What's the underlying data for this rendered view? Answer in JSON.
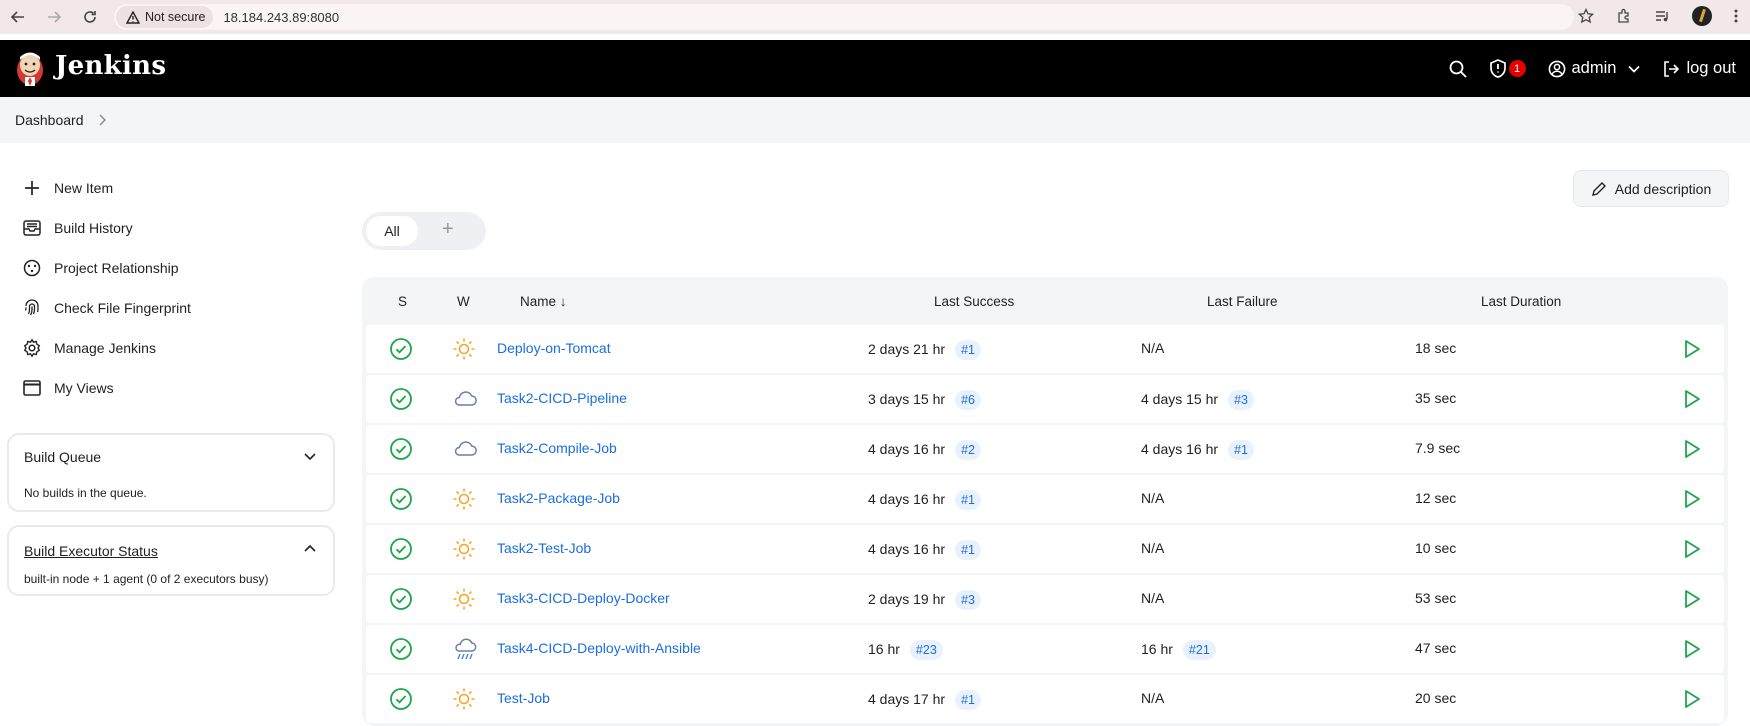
{
  "browser": {
    "not_secure_label": "Not secure",
    "url": "18.184.243.89:8080"
  },
  "header": {
    "title": "Jenkins",
    "security_badge_count": "1",
    "user": "admin",
    "logout": "log out"
  },
  "breadcrumb": {
    "item": "Dashboard"
  },
  "sidebar": {
    "tasks": [
      {
        "label": "New Item",
        "icon": "plus-icon"
      },
      {
        "label": "Build History",
        "icon": "inbox-icon"
      },
      {
        "label": "Project Relationship",
        "icon": "relationship-icon"
      },
      {
        "label": "Check File Fingerprint",
        "icon": "fingerprint-icon"
      },
      {
        "label": "Manage Jenkins",
        "icon": "gear-icon"
      },
      {
        "label": "My Views",
        "icon": "window-icon"
      }
    ],
    "build_queue": {
      "title": "Build Queue",
      "body": "No builds in the queue."
    },
    "executor_status": {
      "title": "Build Executor Status",
      "body": "built-in node + 1 agent (0 of 2 executors busy)"
    }
  },
  "main": {
    "add_description": "Add description",
    "tabs": {
      "all": "All",
      "add": "+"
    },
    "columns": {
      "s": "S",
      "w": "W",
      "name": "Name ↓",
      "last_success": "Last Success",
      "last_failure": "Last Failure",
      "last_duration": "Last Duration"
    },
    "jobs": [
      {
        "name": "Deploy-on-Tomcat",
        "weather": "sun-icon",
        "success": "2 days 21 hr",
        "success_build": "#1",
        "failure": "N/A",
        "failure_build": "",
        "duration": "18 sec"
      },
      {
        "name": "Task2-CICD-Pipeline",
        "weather": "cloud-icon",
        "success": "3 days 15 hr",
        "success_build": "#6",
        "failure": "4 days 15 hr",
        "failure_build": "#3",
        "duration": "35 sec"
      },
      {
        "name": "Task2-Compile-Job",
        "weather": "cloud-icon",
        "success": "4 days 16 hr",
        "success_build": "#2",
        "failure": "4 days 16 hr",
        "failure_build": "#1",
        "duration": "7.9 sec"
      },
      {
        "name": "Task2-Package-Job",
        "weather": "sun-icon",
        "success": "4 days 16 hr",
        "success_build": "#1",
        "failure": "N/A",
        "failure_build": "",
        "duration": "12 sec"
      },
      {
        "name": "Task2-Test-Job",
        "weather": "sun-icon",
        "success": "4 days 16 hr",
        "success_build": "#1",
        "failure": "N/A",
        "failure_build": "",
        "duration": "10 sec"
      },
      {
        "name": "Task3-CICD-Deploy-Docker",
        "weather": "sun-icon",
        "success": "2 days 19 hr",
        "success_build": "#3",
        "failure": "N/A",
        "failure_build": "",
        "duration": "53 sec"
      },
      {
        "name": "Task4-CICD-Deploy-with-Ansible",
        "weather": "rain-icon",
        "success": "16 hr",
        "success_build": "#23",
        "failure": "16 hr",
        "failure_build": "#21",
        "duration": "47 sec"
      },
      {
        "name": "Test-Job",
        "weather": "sun-icon",
        "success": "4 days 17 hr",
        "success_build": "#1",
        "failure": "N/A",
        "failure_build": "",
        "duration": "20 sec"
      }
    ]
  },
  "colors": {
    "accent": "#1a6ee0",
    "success": "#1ea64a",
    "sun": "#f5a623",
    "cloud": "#6b7fa8"
  }
}
